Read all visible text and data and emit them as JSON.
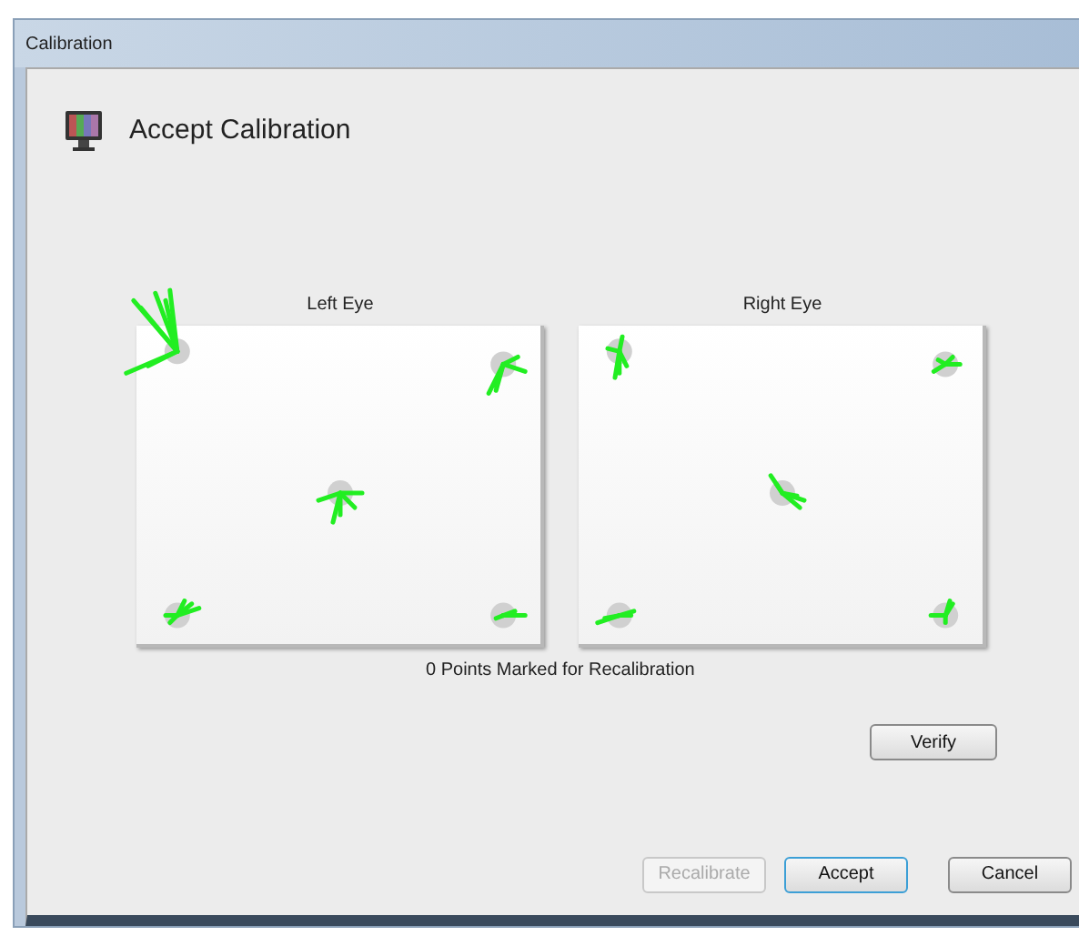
{
  "window": {
    "title": "Calibration"
  },
  "header": {
    "title": "Accept Calibration"
  },
  "plots": [
    {
      "label": "Left Eye"
    },
    {
      "label": "Right Eye"
    }
  ],
  "status": "0 Points Marked for Recalibration",
  "verify_button": {
    "label": "Verify",
    "disabled": false,
    "default": false
  },
  "buttons": [
    {
      "label": "Recalibrate",
      "disabled": true,
      "default": false
    },
    {
      "label": "Accept",
      "disabled": false,
      "default": true
    },
    {
      "label": "Cancel",
      "disabled": false,
      "default": false
    }
  ]
}
